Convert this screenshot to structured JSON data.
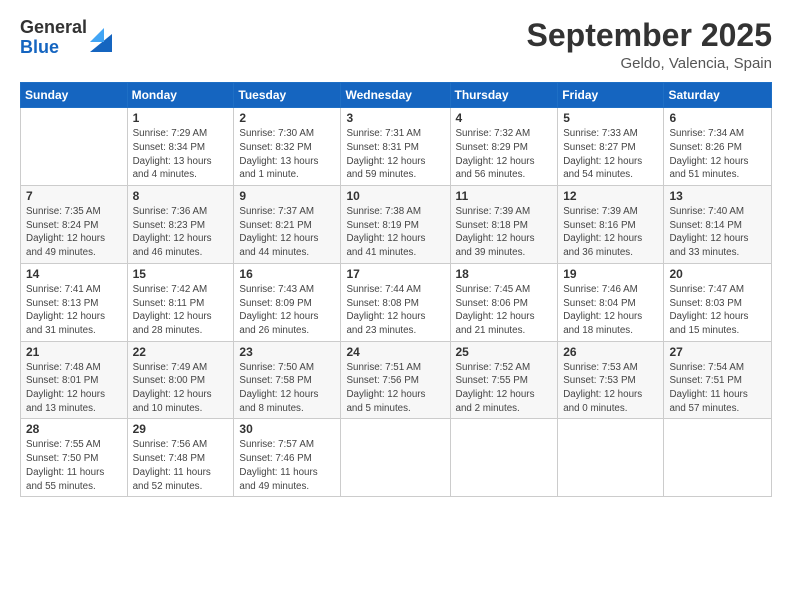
{
  "header": {
    "logo_general": "General",
    "logo_blue": "Blue",
    "month_title": "September 2025",
    "location": "Geldo, Valencia, Spain"
  },
  "days_of_week": [
    "Sunday",
    "Monday",
    "Tuesday",
    "Wednesday",
    "Thursday",
    "Friday",
    "Saturday"
  ],
  "weeks": [
    [
      {
        "day": "",
        "info": ""
      },
      {
        "day": "1",
        "info": "Sunrise: 7:29 AM\nSunset: 8:34 PM\nDaylight: 13 hours\nand 4 minutes."
      },
      {
        "day": "2",
        "info": "Sunrise: 7:30 AM\nSunset: 8:32 PM\nDaylight: 13 hours\nand 1 minute."
      },
      {
        "day": "3",
        "info": "Sunrise: 7:31 AM\nSunset: 8:31 PM\nDaylight: 12 hours\nand 59 minutes."
      },
      {
        "day": "4",
        "info": "Sunrise: 7:32 AM\nSunset: 8:29 PM\nDaylight: 12 hours\nand 56 minutes."
      },
      {
        "day": "5",
        "info": "Sunrise: 7:33 AM\nSunset: 8:27 PM\nDaylight: 12 hours\nand 54 minutes."
      },
      {
        "day": "6",
        "info": "Sunrise: 7:34 AM\nSunset: 8:26 PM\nDaylight: 12 hours\nand 51 minutes."
      }
    ],
    [
      {
        "day": "7",
        "info": "Sunrise: 7:35 AM\nSunset: 8:24 PM\nDaylight: 12 hours\nand 49 minutes."
      },
      {
        "day": "8",
        "info": "Sunrise: 7:36 AM\nSunset: 8:23 PM\nDaylight: 12 hours\nand 46 minutes."
      },
      {
        "day": "9",
        "info": "Sunrise: 7:37 AM\nSunset: 8:21 PM\nDaylight: 12 hours\nand 44 minutes."
      },
      {
        "day": "10",
        "info": "Sunrise: 7:38 AM\nSunset: 8:19 PM\nDaylight: 12 hours\nand 41 minutes."
      },
      {
        "day": "11",
        "info": "Sunrise: 7:39 AM\nSunset: 8:18 PM\nDaylight: 12 hours\nand 39 minutes."
      },
      {
        "day": "12",
        "info": "Sunrise: 7:39 AM\nSunset: 8:16 PM\nDaylight: 12 hours\nand 36 minutes."
      },
      {
        "day": "13",
        "info": "Sunrise: 7:40 AM\nSunset: 8:14 PM\nDaylight: 12 hours\nand 33 minutes."
      }
    ],
    [
      {
        "day": "14",
        "info": "Sunrise: 7:41 AM\nSunset: 8:13 PM\nDaylight: 12 hours\nand 31 minutes."
      },
      {
        "day": "15",
        "info": "Sunrise: 7:42 AM\nSunset: 8:11 PM\nDaylight: 12 hours\nand 28 minutes."
      },
      {
        "day": "16",
        "info": "Sunrise: 7:43 AM\nSunset: 8:09 PM\nDaylight: 12 hours\nand 26 minutes."
      },
      {
        "day": "17",
        "info": "Sunrise: 7:44 AM\nSunset: 8:08 PM\nDaylight: 12 hours\nand 23 minutes."
      },
      {
        "day": "18",
        "info": "Sunrise: 7:45 AM\nSunset: 8:06 PM\nDaylight: 12 hours\nand 21 minutes."
      },
      {
        "day": "19",
        "info": "Sunrise: 7:46 AM\nSunset: 8:04 PM\nDaylight: 12 hours\nand 18 minutes."
      },
      {
        "day": "20",
        "info": "Sunrise: 7:47 AM\nSunset: 8:03 PM\nDaylight: 12 hours\nand 15 minutes."
      }
    ],
    [
      {
        "day": "21",
        "info": "Sunrise: 7:48 AM\nSunset: 8:01 PM\nDaylight: 12 hours\nand 13 minutes."
      },
      {
        "day": "22",
        "info": "Sunrise: 7:49 AM\nSunset: 8:00 PM\nDaylight: 12 hours\nand 10 minutes."
      },
      {
        "day": "23",
        "info": "Sunrise: 7:50 AM\nSunset: 7:58 PM\nDaylight: 12 hours\nand 8 minutes."
      },
      {
        "day": "24",
        "info": "Sunrise: 7:51 AM\nSunset: 7:56 PM\nDaylight: 12 hours\nand 5 minutes."
      },
      {
        "day": "25",
        "info": "Sunrise: 7:52 AM\nSunset: 7:55 PM\nDaylight: 12 hours\nand 2 minutes."
      },
      {
        "day": "26",
        "info": "Sunrise: 7:53 AM\nSunset: 7:53 PM\nDaylight: 12 hours\nand 0 minutes."
      },
      {
        "day": "27",
        "info": "Sunrise: 7:54 AM\nSunset: 7:51 PM\nDaylight: 11 hours\nand 57 minutes."
      }
    ],
    [
      {
        "day": "28",
        "info": "Sunrise: 7:55 AM\nSunset: 7:50 PM\nDaylight: 11 hours\nand 55 minutes."
      },
      {
        "day": "29",
        "info": "Sunrise: 7:56 AM\nSunset: 7:48 PM\nDaylight: 11 hours\nand 52 minutes."
      },
      {
        "day": "30",
        "info": "Sunrise: 7:57 AM\nSunset: 7:46 PM\nDaylight: 11 hours\nand 49 minutes."
      },
      {
        "day": "",
        "info": ""
      },
      {
        "day": "",
        "info": ""
      },
      {
        "day": "",
        "info": ""
      },
      {
        "day": "",
        "info": ""
      }
    ]
  ]
}
